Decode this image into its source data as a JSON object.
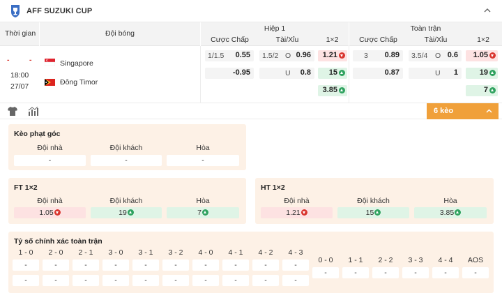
{
  "league": "AFF SUZUKI CUP",
  "columns": {
    "time": "Thời gian",
    "teams": "Đội bóng",
    "half1": "Hiệp 1",
    "full": "Toàn trận",
    "handicap": "Cược Chấp",
    "overunder": "Tài/Xỉu",
    "x12": "1×2"
  },
  "match": {
    "score_home": "-",
    "score_away": "-",
    "time": "18:00",
    "date": "27/07",
    "home": "Singapore",
    "away": "Đông Timor"
  },
  "h1": {
    "hdp_line": "1/1.5",
    "hdp_home": "0.55",
    "hdp_away": "-0.95",
    "ou_line": "1.5/2",
    "ou_o": "O",
    "ou_o_val": "0.96",
    "ou_u": "U",
    "ou_u_val": "0.8",
    "x12_home": "1.21",
    "x12_away": "15",
    "x12_draw": "3.85"
  },
  "ft": {
    "hdp_line": "3",
    "hdp_home": "0.89",
    "hdp_away": "0.87",
    "ou_line": "3.5/4",
    "ou_o": "O",
    "ou_o_val": "0.6",
    "ou_u": "U",
    "ou_u_val": "1",
    "x12_home": "1.05",
    "x12_away": "19",
    "x12_draw": "7"
  },
  "more_bets": "6 kèo",
  "corner": {
    "title": "Kèo phạt góc",
    "home_label": "Đội nhà",
    "away_label": "Đội khách",
    "draw_label": "Hòa",
    "home": "-",
    "away": "-",
    "draw": "-"
  },
  "ft12": {
    "title": "FT 1×2",
    "home_label": "Đội nhà",
    "away_label": "Đội khách",
    "draw_label": "Hòa",
    "home": "1.05",
    "away": "19",
    "draw": "7"
  },
  "ht12": {
    "title": "HT 1×2",
    "home_label": "Đội nhà",
    "away_label": "Đội khách",
    "draw_label": "Hòa",
    "home": "1.21",
    "away": "15",
    "draw": "3.85"
  },
  "correct_score": {
    "title": "Tỷ số chính xác toàn trận",
    "home_scores": [
      "1 - 0",
      "2 - 0",
      "2 - 1",
      "3 - 0",
      "3 - 1",
      "3 - 2",
      "4 - 0",
      "4 - 1",
      "4 - 2",
      "4 - 3"
    ],
    "other_scores": [
      "0 - 0",
      "1 - 1",
      "2 - 2",
      "3 - 3",
      "4 - 4",
      "AOS"
    ],
    "dash": "-"
  },
  "colors": {
    "accent": "#f0a03a",
    "up": "#2fa25f",
    "down": "#d9362f",
    "red_bg": "#fde2e2",
    "green_bg": "#dff4e6",
    "panel_bg": "#fdf1e6"
  }
}
